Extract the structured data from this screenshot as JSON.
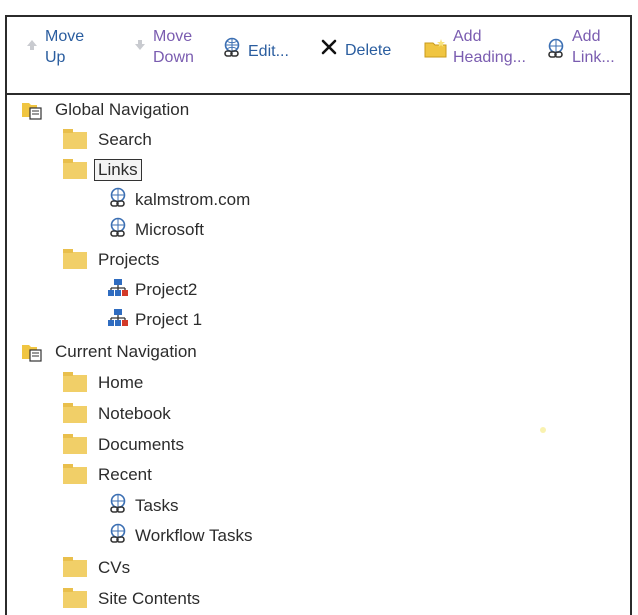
{
  "toolbar": {
    "move_up": {
      "line1": "Move",
      "line2": "Up",
      "icon": "arrow-up-icon"
    },
    "move_down": {
      "line1": "Move",
      "line2": "Down",
      "icon": "arrow-down-icon"
    },
    "edit": {
      "label": "Edit...",
      "icon": "link-edit-icon"
    },
    "delete": {
      "label": "Delete",
      "icon": "close-icon"
    },
    "add_heading": {
      "line1": "Add",
      "line2": "Heading...",
      "icon": "folder-add-icon"
    },
    "add_link": {
      "line1": "Add",
      "line2": "Link...",
      "icon": "link-add-icon"
    }
  },
  "tree": [
    {
      "label": "Global Navigation",
      "type": "root"
    },
    {
      "label": "Search",
      "type": "folder"
    },
    {
      "label": "Links",
      "type": "folder",
      "selected": true
    },
    {
      "label": "kalmstrom.com",
      "type": "link"
    },
    {
      "label": "Microsoft",
      "type": "link"
    },
    {
      "label": "Projects",
      "type": "folder"
    },
    {
      "label": "Project2",
      "type": "site"
    },
    {
      "label": "Project 1",
      "type": "site"
    },
    {
      "label": "Current Navigation",
      "type": "root"
    },
    {
      "label": "Home",
      "type": "folder"
    },
    {
      "label": "Notebook",
      "type": "folder"
    },
    {
      "label": "Documents",
      "type": "folder"
    },
    {
      "label": "Recent",
      "type": "folder"
    },
    {
      "label": "Tasks",
      "type": "link"
    },
    {
      "label": "Workflow Tasks",
      "type": "link"
    },
    {
      "label": "CVs",
      "type": "folder"
    },
    {
      "label": "Site Contents",
      "type": "folder"
    }
  ],
  "colors": {
    "link_blue": "#2a5d9f",
    "folder_yellow": "#f1cf68",
    "purple_label": "#7a5cb0"
  }
}
